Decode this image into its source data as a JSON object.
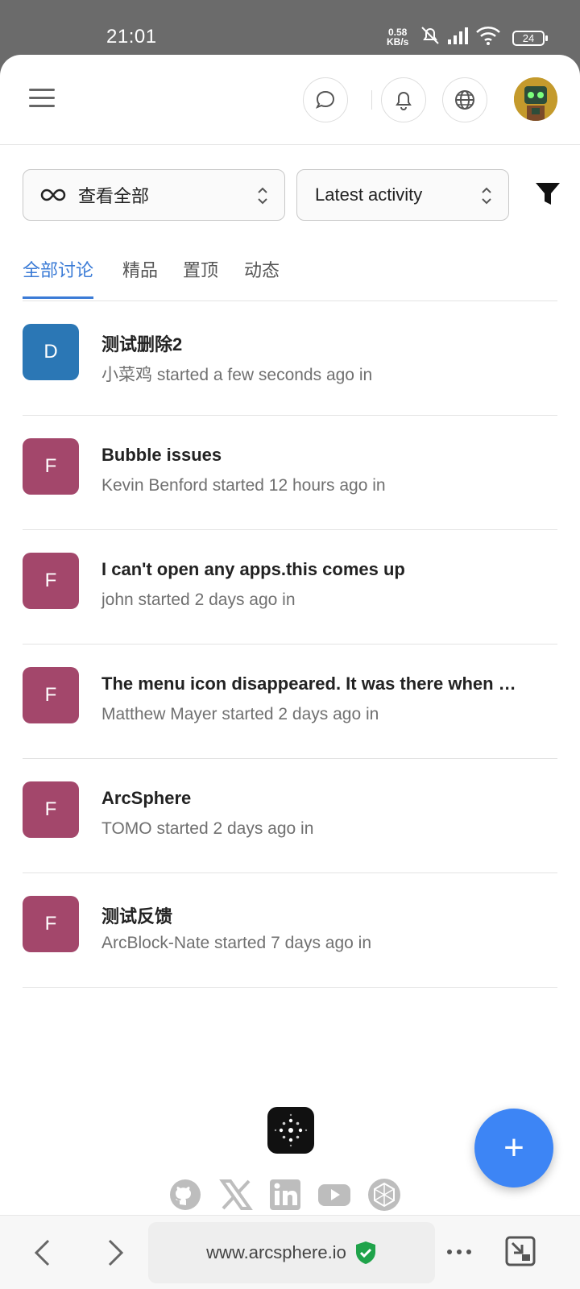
{
  "status_bar": {
    "time": "21:01",
    "net_rate": "0.58",
    "net_unit": "KB/s",
    "battery": "24"
  },
  "header": {
    "icons": [
      "menu-icon",
      "chat-icon",
      "bell-icon",
      "globe-icon",
      "avatar"
    ]
  },
  "filters": {
    "scope_label": "查看全部",
    "sort_label": "Latest activity"
  },
  "tabs": [
    {
      "label": "全部讨论",
      "active": true
    },
    {
      "label": "精品",
      "active": false
    },
    {
      "label": "置顶",
      "active": false
    },
    {
      "label": "动态",
      "active": false
    }
  ],
  "discussions": [
    {
      "letter": "D",
      "color": "#2b77b5",
      "title": "测试删除2",
      "meta": "小菜鸡 started a few seconds ago in"
    },
    {
      "letter": "F",
      "color": "#a3476b",
      "title": "Bubble issues",
      "meta": "Kevin Benford started 12 hours ago in"
    },
    {
      "letter": "F",
      "color": "#a3476b",
      "title": "I can't open any apps.this comes up",
      "meta": "john started 2 days ago in"
    },
    {
      "letter": "F",
      "color": "#a3476b",
      "title": "The menu icon disappeared. It was there when …",
      "meta": "Matthew Mayer started 2 days ago in"
    },
    {
      "letter": "F",
      "color": "#a3476b",
      "title": "ArcSphere",
      "meta": "TOMO started 2 days ago in"
    },
    {
      "letter": "F",
      "color": "#a3476b",
      "title": "测试反馈",
      "meta": "ArcBlock-Nate started 7 days ago in"
    }
  ],
  "footer": {
    "social_icons": [
      "github-icon",
      "x-icon",
      "linkedin-icon",
      "youtube-icon",
      "arcblock-icon"
    ],
    "fab_label": "+"
  },
  "browser": {
    "url": "www.arcsphere.io"
  },
  "colors": {
    "accent": "#3b7bd6",
    "fab": "#3d85f5"
  }
}
